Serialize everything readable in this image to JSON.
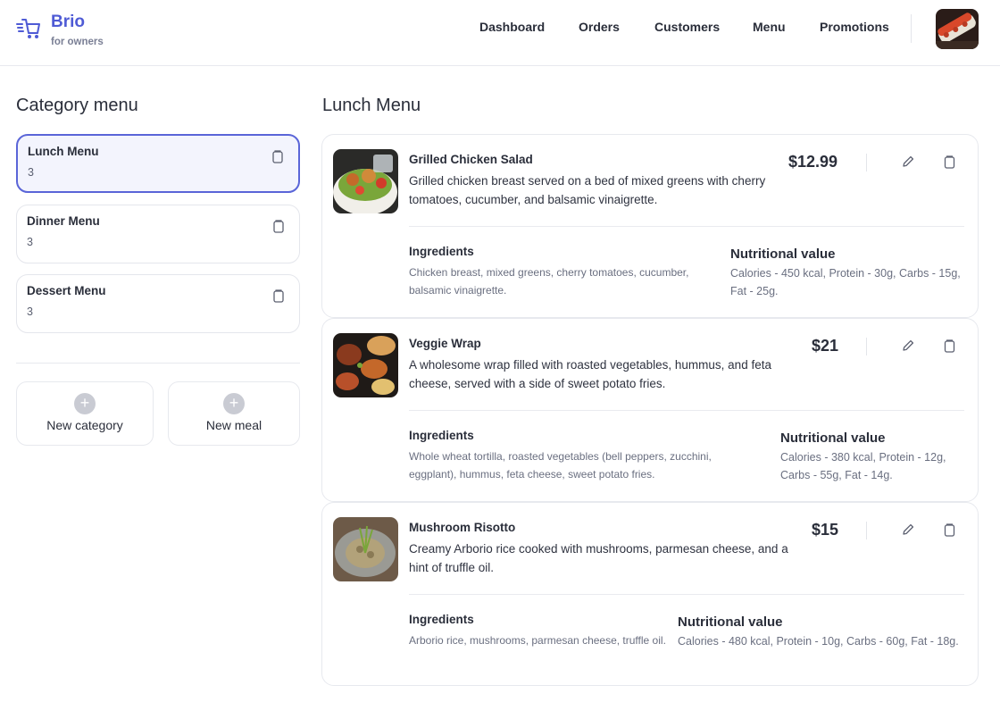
{
  "brand": {
    "title": "Brio",
    "subtitle": "for owners"
  },
  "nav": [
    "Dashboard",
    "Orders",
    "Customers",
    "Menu",
    "Promotions"
  ],
  "sidebar": {
    "title": "Category menu",
    "categories": [
      {
        "name": "Lunch Menu",
        "count": "3",
        "active": true
      },
      {
        "name": "Dinner Menu",
        "count": "3",
        "active": false
      },
      {
        "name": "Dessert Menu",
        "count": "3",
        "active": false
      }
    ],
    "new_category": "New category",
    "new_meal": "New meal"
  },
  "main": {
    "title": "Lunch Menu",
    "ingredients_label": "Ingredients",
    "nutrition_label": "Nutritional value",
    "meals": [
      {
        "name": "Grilled Chicken Salad",
        "description": "Grilled chicken breast served on a bed of mixed greens with cherry tomatoes, cucumber, and balsamic vinaigrette.",
        "price": "$12.99",
        "ingredients": "Chicken breast, mixed greens, cherry tomatoes, cucumber, balsamic vinaigrette.",
        "nutrition": "Calories - 450 kcal, Protein - 30g, Carbs - 15g, Fat - 25g."
      },
      {
        "name": "Veggie Wrap",
        "description": "A wholesome wrap filled with roasted vegetables, hummus, and feta cheese, served with a side of sweet potato fries.",
        "price": "$21",
        "ingredients": "Whole wheat tortilla, roasted vegetables (bell peppers, zucchini, eggplant), hummus, feta cheese, sweet potato fries.",
        "nutrition": "Calories - 380 kcal, Protein - 12g, Carbs - 55g, Fat - 14g."
      },
      {
        "name": "Mushroom Risotto",
        "description": "Creamy Arborio rice cooked with mushrooms, parmesan cheese, and a hint of truffle oil.",
        "price": "$15",
        "ingredients": "Arborio rice, mushrooms, parmesan cheese, truffle oil.",
        "nutrition": "Calories - 480 kcal, Protein - 10g, Carbs - 60g, Fat - 18g."
      }
    ]
  },
  "colors": {
    "accent": "#4f5bd5",
    "active_border": "#5a65d8",
    "active_bg": "#f3f4fd"
  },
  "icons": [
    "cart-icon",
    "trash-icon",
    "edit-icon",
    "plus-icon"
  ]
}
